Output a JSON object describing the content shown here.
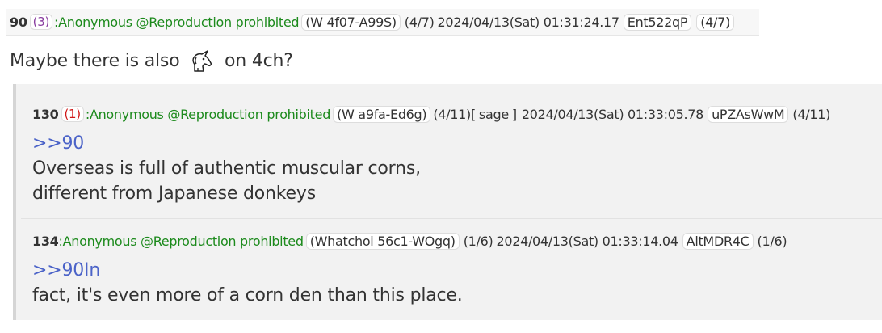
{
  "post90": {
    "number": "90",
    "replies": "(3)",
    "name": ":Anonymous @Reproduction prohibited",
    "id_tag": "(W 4f07-A99S)",
    "count": "(4/7)",
    "datetime": "2024/04/13(Sat) 01:31:24.17",
    "trip": "Ent522qP",
    "count2": "(4/7)",
    "message_before": "Maybe there is also",
    "message_icon": "unicorn-emoji-icon",
    "message_after": "on 4ch?"
  },
  "post130": {
    "number": "130",
    "replies": "(1)",
    "name": ":Anonymous @Reproduction prohibited",
    "id_tag": "(W a9fa-Ed6g)",
    "count": "(4/11)[",
    "sage": "sage",
    "bracket_close": "]",
    "datetime": "2024/04/13(Sat) 01:33:05.78",
    "trip": "uPZAsWwM",
    "count2": "(4/11)",
    "quote": ">>90",
    "line1": "Overseas is full of authentic muscular corns,",
    "line2": "different from Japanese donkeys"
  },
  "post134": {
    "number": "134",
    "name": ":Anonymous @Reproduction prohibited",
    "id_tag": "(Whatchoi 56c1-WOgq)",
    "count": "(1/6)",
    "datetime": "2024/04/13(Sat) 01:33:14.04",
    "trip": "AltMDR4C",
    "count2": "(1/6)",
    "quote": ">>90In",
    "line1": "fact, it's even more of a corn den than this place."
  },
  "colors": {
    "name_green": "#1c8a1c",
    "quote_blue": "#4b63c8",
    "reply_red": "#d01818",
    "reply_purple": "#8a3fa0"
  }
}
